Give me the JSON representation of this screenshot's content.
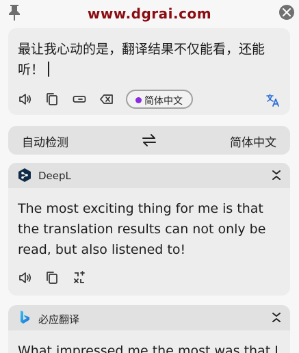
{
  "header": {
    "watermark": "www.dgrai.com"
  },
  "source": {
    "text": "最让我心动的是，翻译结果不仅能看，还能听！",
    "target_language": "简体中文",
    "pill_dot_color": "#8a2be2"
  },
  "language_bar": {
    "from": "自动检测",
    "to": "简体中文"
  },
  "results": [
    {
      "engine": "DeepL",
      "text": "The most exciting thing for me is that the translation results can not only be read, but also listened to!"
    },
    {
      "engine": "必应翻译",
      "text": "What impressed me the most was that I"
    }
  ],
  "colors": {
    "watermark": "#8b0d12",
    "accent": "#2a6fd6",
    "card_bg": "#ededed",
    "header_bg": "#e1e1e1"
  },
  "icons": [
    "pin-icon",
    "close-icon",
    "speaker-icon",
    "copy-icon",
    "keyboard-icon",
    "clear-icon",
    "translate-icon",
    "swap-icon",
    "deepl-logo",
    "bing-logo",
    "collapse-icon",
    "compare-icon"
  ]
}
